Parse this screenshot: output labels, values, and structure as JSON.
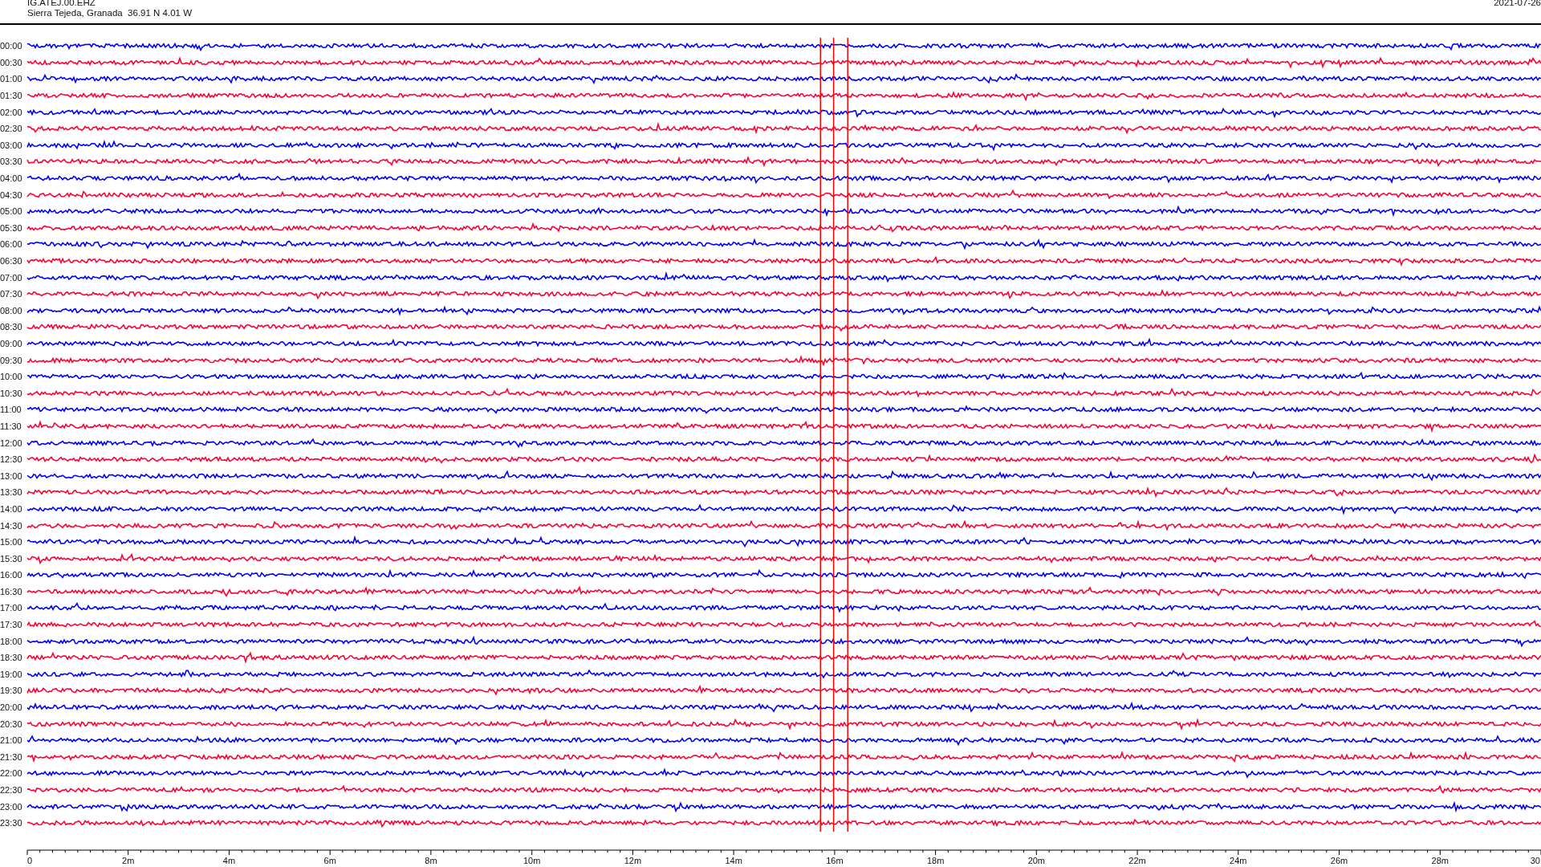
{
  "header": {
    "station": "IG.ATEJ.00.EHZ",
    "location": "Sierra Tejeda, Granada  36.91 N 4.01 W",
    "date": "2021-07-26"
  },
  "traces": [
    {
      "time": "00:00",
      "color": "#0000ff"
    },
    {
      "time": "00:30",
      "color": "#ff0033"
    },
    {
      "time": "01:00",
      "color": "#0000ff"
    },
    {
      "time": "01:30",
      "color": "#ff0033"
    },
    {
      "time": "02:00",
      "color": "#0000ff"
    },
    {
      "time": "02:30",
      "color": "#ff0033"
    },
    {
      "time": "03:00",
      "color": "#0000ff"
    },
    {
      "time": "03:30",
      "color": "#ff0033"
    },
    {
      "time": "04:00",
      "color": "#0000ff"
    },
    {
      "time": "04:30",
      "color": "#ff0033"
    },
    {
      "time": "05:00",
      "color": "#0000ff"
    },
    {
      "time": "05:30",
      "color": "#ff0033"
    },
    {
      "time": "06:00",
      "color": "#0000ff"
    },
    {
      "time": "06:30",
      "color": "#ff0033"
    },
    {
      "time": "07:00",
      "color": "#0000ff"
    },
    {
      "time": "07:30",
      "color": "#ff0033"
    },
    {
      "time": "08:00",
      "color": "#0000ff"
    },
    {
      "time": "08:30",
      "color": "#ff0033"
    },
    {
      "time": "09:00",
      "color": "#0000ff"
    },
    {
      "time": "09:30",
      "color": "#ff0033"
    },
    {
      "time": "10:00",
      "color": "#0000ff"
    },
    {
      "time": "10:30",
      "color": "#ff0033"
    },
    {
      "time": "11:00",
      "color": "#0000ff"
    },
    {
      "time": "11:30",
      "color": "#ff0033"
    },
    {
      "time": "12:00",
      "color": "#0000ff"
    },
    {
      "time": "12:30",
      "color": "#ff0033"
    },
    {
      "time": "13:00",
      "color": "#0000ff"
    },
    {
      "time": "13:30",
      "color": "#ff0033"
    },
    {
      "time": "14:00",
      "color": "#0000ff"
    },
    {
      "time": "14:30",
      "color": "#ff0033"
    },
    {
      "time": "15:00",
      "color": "#0000ff"
    },
    {
      "time": "15:30",
      "color": "#ff0033"
    },
    {
      "time": "16:00",
      "color": "#0000ff"
    },
    {
      "time": "16:30",
      "color": "#ff0033"
    },
    {
      "time": "17:00",
      "color": "#0000ff"
    },
    {
      "time": "17:30",
      "color": "#ff0033"
    },
    {
      "time": "18:00",
      "color": "#0000ff"
    },
    {
      "time": "18:30",
      "color": "#ff0033"
    },
    {
      "time": "19:00",
      "color": "#0000ff"
    },
    {
      "time": "19:30",
      "color": "#ff0033"
    },
    {
      "time": "20:00",
      "color": "#0000ff"
    },
    {
      "time": "20:30",
      "color": "#ff0033"
    },
    {
      "time": "21:00",
      "color": "#0000ff"
    },
    {
      "time": "21:30",
      "color": "#ff0033"
    },
    {
      "time": "22:00",
      "color": "#0000ff"
    },
    {
      "time": "22:30",
      "color": "#ff0033"
    },
    {
      "time": "23:00",
      "color": "#0000ff"
    },
    {
      "time": "23:30",
      "color": "#ff0033"
    }
  ],
  "x_axis": {
    "tick_labels": [
      "0",
      "2m",
      "4m",
      "6m",
      "8m",
      "10m",
      "12m",
      "14m",
      "16m",
      "18m",
      "20m",
      "22m",
      "24m",
      "26m",
      "28m",
      "30"
    ]
  }
}
